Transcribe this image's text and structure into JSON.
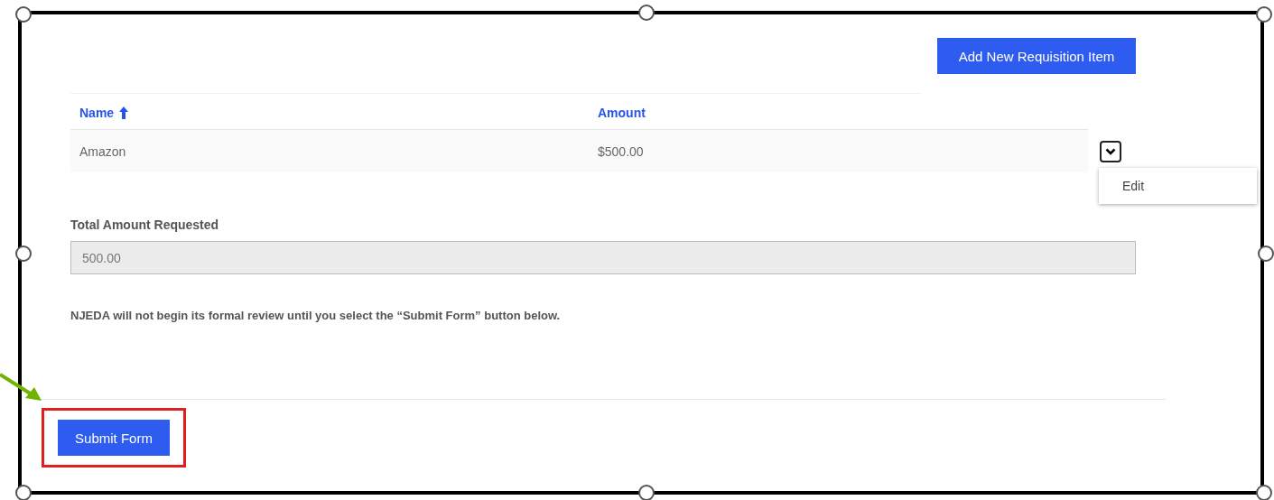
{
  "toolbar": {
    "add_button": "Add New Requisition Item"
  },
  "table": {
    "columns": [
      {
        "label": "Name",
        "sorted": true
      },
      {
        "label": "Amount",
        "sorted": false
      }
    ],
    "rows": [
      {
        "cells": [
          "Amazon",
          "$500.00"
        ],
        "menu_open": true,
        "menu_items": [
          "Edit"
        ]
      }
    ]
  },
  "total": {
    "label": "Total Amount Requested",
    "value": "500.00",
    "disabled": true
  },
  "notice": "NJEDA will not begin its formal review until you select the “Submit Form” button below.",
  "submit": {
    "label": "Submit Form",
    "highlighted": true
  }
}
